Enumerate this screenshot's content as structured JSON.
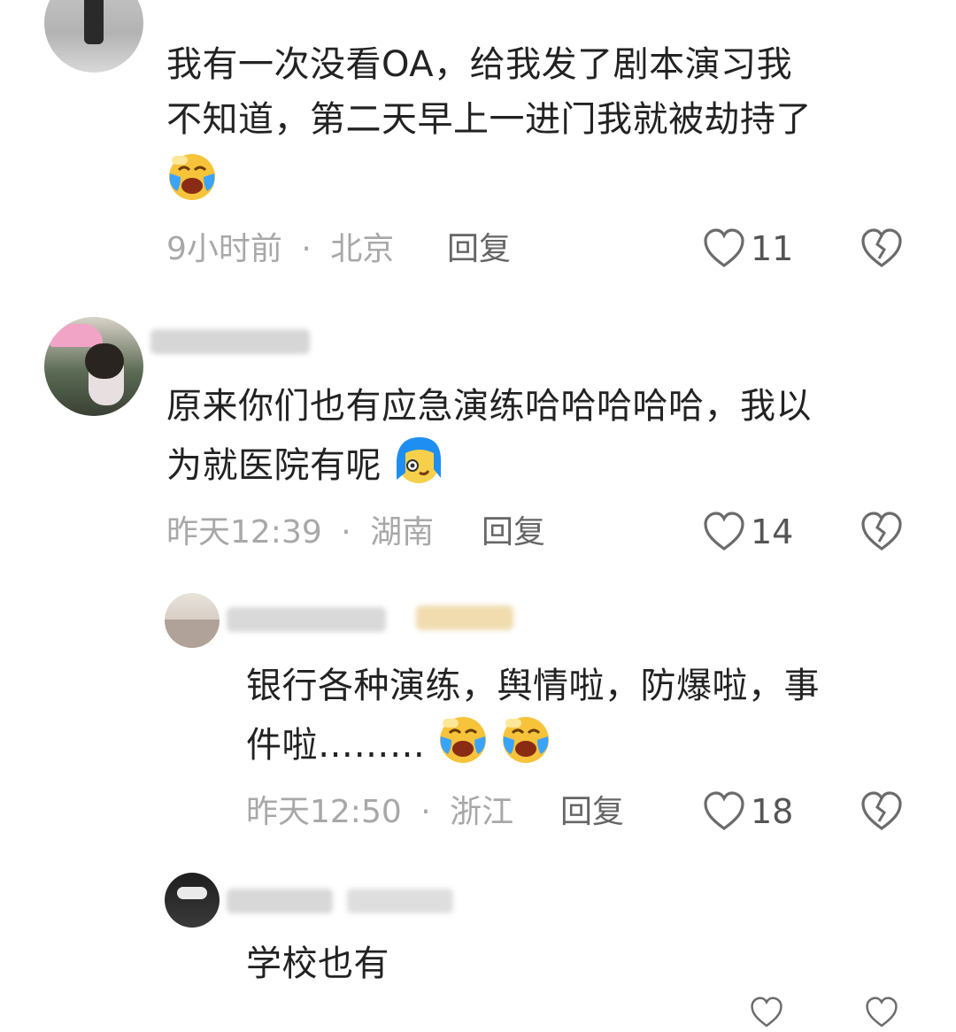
{
  "comments": [
    {
      "text_line1": "我有一次没看OA，给我发了剧本演习我",
      "text_line2": "不知道，第二天早上一进门我就被劫持了",
      "time": "9小时前",
      "location": "北京",
      "reply_label": "回复",
      "likes": "11",
      "emojis": [
        "crying-laughing"
      ]
    },
    {
      "text_line1": "原来你们也有应急演练哈哈哈哈哈，我以",
      "text_line2": "为就医院有呢",
      "time": "昨天12:39",
      "location": "湖南",
      "reply_label": "回复",
      "likes": "14",
      "emojis": [
        "blue-hair-sweat"
      ]
    },
    {
      "text_line1": "银行各种演练，舆情啦，防爆啦，事",
      "text_line2": "件啦………",
      "time": "昨天12:50",
      "location": "浙江",
      "reply_label": "回复",
      "likes": "18",
      "emojis": [
        "crying-laughing",
        "crying-laughing"
      ]
    },
    {
      "text_line1": "学校也有"
    }
  ],
  "meta_separator": "·",
  "icons": [
    "heart-outline-icon",
    "broken-heart-icon"
  ],
  "colors": {
    "text": "#222222",
    "meta": "#a8a8a8",
    "reply": "#666666",
    "icon": "#6b6b6b"
  }
}
